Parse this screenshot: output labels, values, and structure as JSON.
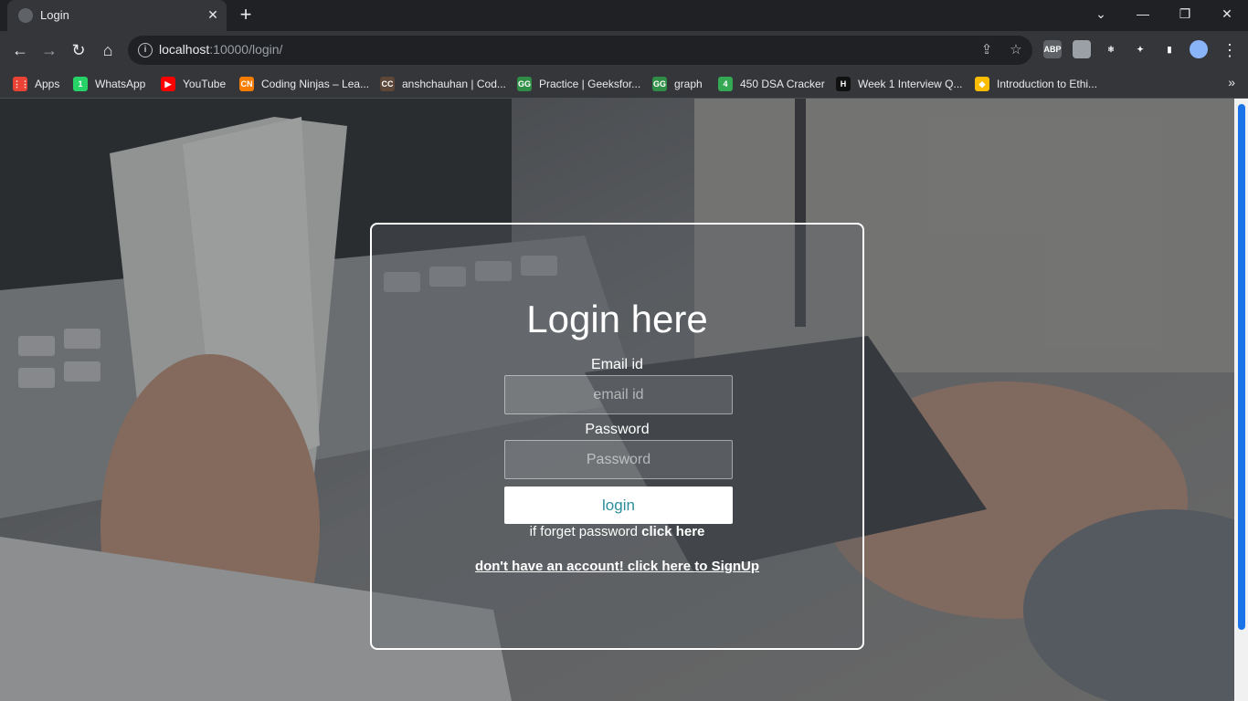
{
  "browser": {
    "tab_title": "Login",
    "close_tab": "✕",
    "new_tab": "+",
    "window": {
      "minimize": "—",
      "restore": "❐",
      "close": "✕",
      "tab_search": "⌄"
    },
    "url_host": "localhost",
    "url_rest": ":10000/login/",
    "nav": {
      "back": "←",
      "forward": "→",
      "reload": "↻",
      "home": "⌂"
    },
    "omnibox_icons": {
      "share": "⇪",
      "bookmark": "☆",
      "info": "i"
    },
    "extensions": [
      {
        "name": "adblock-icon",
        "text": "ABP",
        "color": "#5f6368"
      },
      {
        "name": "touch-extension-icon",
        "text": "",
        "color": "#9aa0a6"
      },
      {
        "name": "react-devtools-icon",
        "text": "⚛",
        "color": "#35363a"
      },
      {
        "name": "extensions-puzzle-icon",
        "text": "✦",
        "color": "#35363a"
      },
      {
        "name": "sidepanel-icon",
        "text": "▮",
        "color": "#35363a"
      },
      {
        "name": "profile-avatar-icon",
        "text": "",
        "color": "#8ab4f8"
      }
    ],
    "menu": "⋮"
  },
  "bookmarks": [
    {
      "label": "Apps",
      "icon": "apps-grid-icon",
      "glyph": "⋮⋮",
      "color": "#ea4335"
    },
    {
      "label": "WhatsApp",
      "icon": "whatsapp-icon",
      "glyph": "1",
      "color": "#25d366"
    },
    {
      "label": "YouTube",
      "icon": "youtube-icon",
      "glyph": "▶",
      "color": "#ff0000"
    },
    {
      "label": "Coding Ninjas – Lea...",
      "icon": "coding-ninjas-icon",
      "glyph": "CN",
      "color": "#f57c00"
    },
    {
      "label": "anshchauhan | Cod...",
      "icon": "codechef-icon",
      "glyph": "CC",
      "color": "#5b4638"
    },
    {
      "label": "Practice | Geeksfor...",
      "icon": "geeksforgeeks-icon",
      "glyph": "GG",
      "color": "#2f8d46"
    },
    {
      "label": "graph",
      "icon": "geeksforgeeks-icon",
      "glyph": "GG",
      "color": "#2f8d46"
    },
    {
      "label": "450 DSA Cracker",
      "icon": "dsa-cracker-icon",
      "glyph": "4",
      "color": "#34a853"
    },
    {
      "label": "Week 1 Interview Q...",
      "icon": "hackerrank-icon",
      "glyph": "H",
      "color": "#111111"
    },
    {
      "label": "Introduction to Ethi...",
      "icon": "colab-icon",
      "glyph": "◆",
      "color": "#fbbc04"
    }
  ],
  "bookmarks_more": "»",
  "login": {
    "title": "Login here",
    "email_label": "Email id",
    "email_placeholder": "email id",
    "password_label": "Password",
    "password_placeholder": "Password",
    "button": "login",
    "forget_text": "if forget password ",
    "forget_link": "click here",
    "signup_text": "don't have an account! click here to SignUp"
  }
}
